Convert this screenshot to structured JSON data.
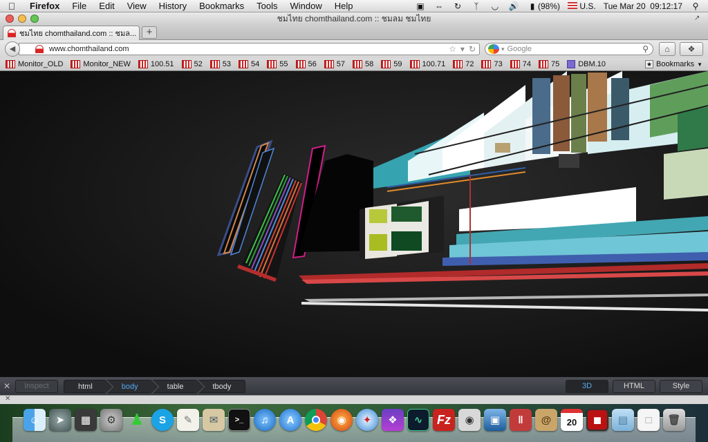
{
  "menubar": {
    "apple_icon": "apple-icon",
    "app_name": "Firefox",
    "menus": [
      "File",
      "Edit",
      "View",
      "History",
      "Bookmarks",
      "Tools",
      "Window",
      "Help"
    ],
    "battery": "(98%)",
    "input_source": "U.S.",
    "clock": "Tue Mar 20  09:12:17"
  },
  "window": {
    "title": "ชมไทย chomthailand.com :: ชมลม ชมไทย"
  },
  "tabs": [
    {
      "label": "ชมไทย chomthailand.com :: ชมล..."
    }
  ],
  "navbar": {
    "url": "www.chomthailand.com",
    "search_placeholder": "Google"
  },
  "bookmarks": {
    "items": [
      "Monitor_OLD",
      "Monitor_NEW",
      "100.51",
      "52",
      "53",
      "54",
      "55",
      "56",
      "57",
      "58",
      "59",
      "100.71",
      "72",
      "73",
      "74",
      "75",
      "DBM.10"
    ],
    "menu_label": "Bookmarks"
  },
  "inspector": {
    "inspect_label": "Inspect",
    "breadcrumbs": [
      "html",
      "body",
      "table",
      "tbody"
    ],
    "active_crumb": "body",
    "buttons": [
      "3D",
      "HTML",
      "Style"
    ],
    "active_button": "3D"
  },
  "dock": {
    "calendar_day": "20",
    "apps": [
      "finder",
      "launchpad",
      "dashboard",
      "system-preferences",
      "adium",
      "skype",
      "textedit",
      "mail",
      "terminal",
      "itunes",
      "app-store",
      "chrome",
      "firefox",
      "safari",
      "rubymine",
      "activity-monitor",
      "filezilla",
      "facetime",
      "virtualbox",
      "parallels",
      "address-book",
      "calendar",
      "photo-booth",
      "folder",
      "document",
      "trash"
    ]
  }
}
